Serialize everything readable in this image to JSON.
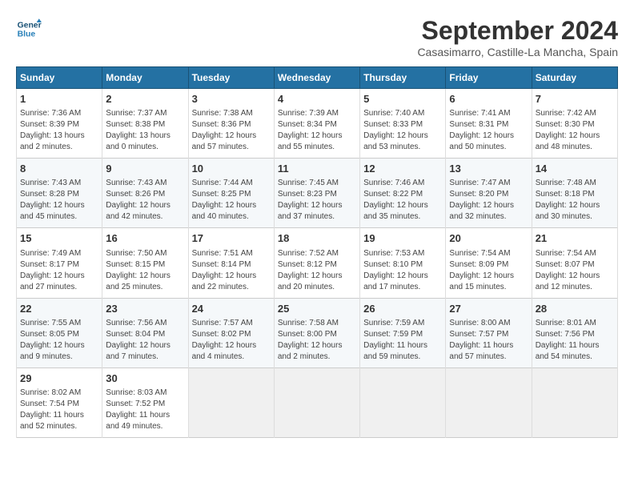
{
  "logo": {
    "line1": "General",
    "line2": "Blue"
  },
  "title": "September 2024",
  "subtitle": "Casasimarro, Castille-La Mancha, Spain",
  "headers": [
    "Sunday",
    "Monday",
    "Tuesday",
    "Wednesday",
    "Thursday",
    "Friday",
    "Saturday"
  ],
  "weeks": [
    [
      {
        "day": "1",
        "info": "Sunrise: 7:36 AM\nSunset: 8:39 PM\nDaylight: 13 hours\nand 2 minutes."
      },
      {
        "day": "2",
        "info": "Sunrise: 7:37 AM\nSunset: 8:38 PM\nDaylight: 13 hours\nand 0 minutes."
      },
      {
        "day": "3",
        "info": "Sunrise: 7:38 AM\nSunset: 8:36 PM\nDaylight: 12 hours\nand 57 minutes."
      },
      {
        "day": "4",
        "info": "Sunrise: 7:39 AM\nSunset: 8:34 PM\nDaylight: 12 hours\nand 55 minutes."
      },
      {
        "day": "5",
        "info": "Sunrise: 7:40 AM\nSunset: 8:33 PM\nDaylight: 12 hours\nand 53 minutes."
      },
      {
        "day": "6",
        "info": "Sunrise: 7:41 AM\nSunset: 8:31 PM\nDaylight: 12 hours\nand 50 minutes."
      },
      {
        "day": "7",
        "info": "Sunrise: 7:42 AM\nSunset: 8:30 PM\nDaylight: 12 hours\nand 48 minutes."
      }
    ],
    [
      {
        "day": "8",
        "info": "Sunrise: 7:43 AM\nSunset: 8:28 PM\nDaylight: 12 hours\nand 45 minutes."
      },
      {
        "day": "9",
        "info": "Sunrise: 7:43 AM\nSunset: 8:26 PM\nDaylight: 12 hours\nand 42 minutes."
      },
      {
        "day": "10",
        "info": "Sunrise: 7:44 AM\nSunset: 8:25 PM\nDaylight: 12 hours\nand 40 minutes."
      },
      {
        "day": "11",
        "info": "Sunrise: 7:45 AM\nSunset: 8:23 PM\nDaylight: 12 hours\nand 37 minutes."
      },
      {
        "day": "12",
        "info": "Sunrise: 7:46 AM\nSunset: 8:22 PM\nDaylight: 12 hours\nand 35 minutes."
      },
      {
        "day": "13",
        "info": "Sunrise: 7:47 AM\nSunset: 8:20 PM\nDaylight: 12 hours\nand 32 minutes."
      },
      {
        "day": "14",
        "info": "Sunrise: 7:48 AM\nSunset: 8:18 PM\nDaylight: 12 hours\nand 30 minutes."
      }
    ],
    [
      {
        "day": "15",
        "info": "Sunrise: 7:49 AM\nSunset: 8:17 PM\nDaylight: 12 hours\nand 27 minutes."
      },
      {
        "day": "16",
        "info": "Sunrise: 7:50 AM\nSunset: 8:15 PM\nDaylight: 12 hours\nand 25 minutes."
      },
      {
        "day": "17",
        "info": "Sunrise: 7:51 AM\nSunset: 8:14 PM\nDaylight: 12 hours\nand 22 minutes."
      },
      {
        "day": "18",
        "info": "Sunrise: 7:52 AM\nSunset: 8:12 PM\nDaylight: 12 hours\nand 20 minutes."
      },
      {
        "day": "19",
        "info": "Sunrise: 7:53 AM\nSunset: 8:10 PM\nDaylight: 12 hours\nand 17 minutes."
      },
      {
        "day": "20",
        "info": "Sunrise: 7:54 AM\nSunset: 8:09 PM\nDaylight: 12 hours\nand 15 minutes."
      },
      {
        "day": "21",
        "info": "Sunrise: 7:54 AM\nSunset: 8:07 PM\nDaylight: 12 hours\nand 12 minutes."
      }
    ],
    [
      {
        "day": "22",
        "info": "Sunrise: 7:55 AM\nSunset: 8:05 PM\nDaylight: 12 hours\nand 9 minutes."
      },
      {
        "day": "23",
        "info": "Sunrise: 7:56 AM\nSunset: 8:04 PM\nDaylight: 12 hours\nand 7 minutes."
      },
      {
        "day": "24",
        "info": "Sunrise: 7:57 AM\nSunset: 8:02 PM\nDaylight: 12 hours\nand 4 minutes."
      },
      {
        "day": "25",
        "info": "Sunrise: 7:58 AM\nSunset: 8:00 PM\nDaylight: 12 hours\nand 2 minutes."
      },
      {
        "day": "26",
        "info": "Sunrise: 7:59 AM\nSunset: 7:59 PM\nDaylight: 11 hours\nand 59 minutes."
      },
      {
        "day": "27",
        "info": "Sunrise: 8:00 AM\nSunset: 7:57 PM\nDaylight: 11 hours\nand 57 minutes."
      },
      {
        "day": "28",
        "info": "Sunrise: 8:01 AM\nSunset: 7:56 PM\nDaylight: 11 hours\nand 54 minutes."
      }
    ],
    [
      {
        "day": "29",
        "info": "Sunrise: 8:02 AM\nSunset: 7:54 PM\nDaylight: 11 hours\nand 52 minutes."
      },
      {
        "day": "30",
        "info": "Sunrise: 8:03 AM\nSunset: 7:52 PM\nDaylight: 11 hours\nand 49 minutes."
      },
      {
        "day": "",
        "info": ""
      },
      {
        "day": "",
        "info": ""
      },
      {
        "day": "",
        "info": ""
      },
      {
        "day": "",
        "info": ""
      },
      {
        "day": "",
        "info": ""
      }
    ]
  ]
}
